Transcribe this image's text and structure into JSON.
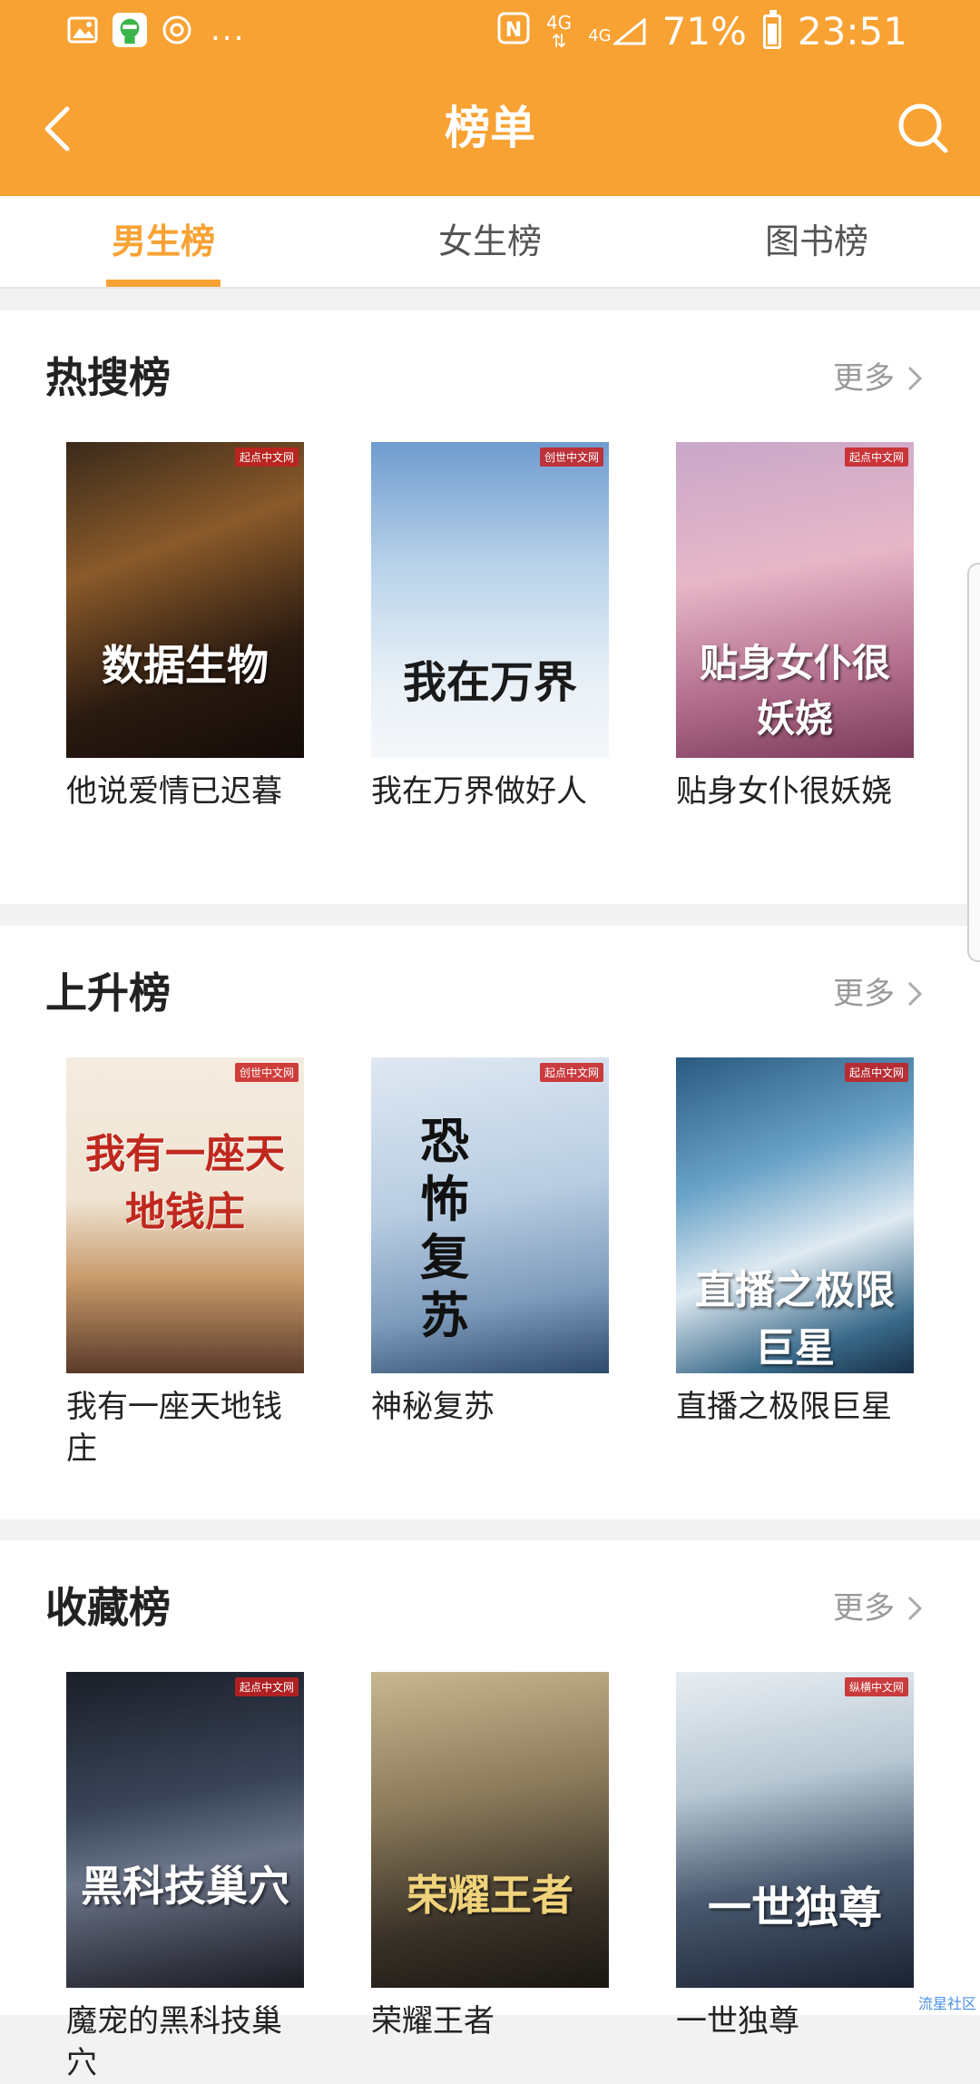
{
  "status_bar": {
    "network_top": "4G",
    "network_bottom": "4G",
    "battery": "71%",
    "time": "23:51",
    "more_indicator": "..."
  },
  "header": {
    "title": "榜单",
    "back_icon": "chevron-left-icon",
    "search_icon": "search-icon"
  },
  "tabs": [
    {
      "label": "男生榜",
      "active": true
    },
    {
      "label": "女生榜",
      "active": false
    },
    {
      "label": "图书榜",
      "active": false
    }
  ],
  "sections": [
    {
      "title": "热搜榜",
      "more_label": "更多",
      "books": [
        {
          "title": "他说爱情已迟暮",
          "cover_text": "数据生物"
        },
        {
          "title": "我在万界做好人",
          "cover_text": "我在万界"
        },
        {
          "title": "贴身女仆很妖娆",
          "cover_text": "贴身女仆很妖娆"
        }
      ]
    },
    {
      "title": "上升榜",
      "more_label": "更多",
      "books": [
        {
          "title": "我有一座天地钱庄",
          "cover_text": "我有一座天地钱庄"
        },
        {
          "title": "神秘复苏",
          "cover_text": "恐怖复苏"
        },
        {
          "title": "直播之极限巨星",
          "cover_text": "直播之极限巨星"
        }
      ]
    },
    {
      "title": "收藏榜",
      "more_label": "更多",
      "books": [
        {
          "title": "魔宠的黑科技巢穴",
          "cover_text": "黑科技巢穴"
        },
        {
          "title": "荣耀王者",
          "cover_text": "荣耀王者"
        },
        {
          "title": "一世独尊",
          "cover_text": "一世独尊"
        }
      ]
    }
  ],
  "watermark": "流星社区",
  "colors": {
    "accent": "#f8a233"
  }
}
